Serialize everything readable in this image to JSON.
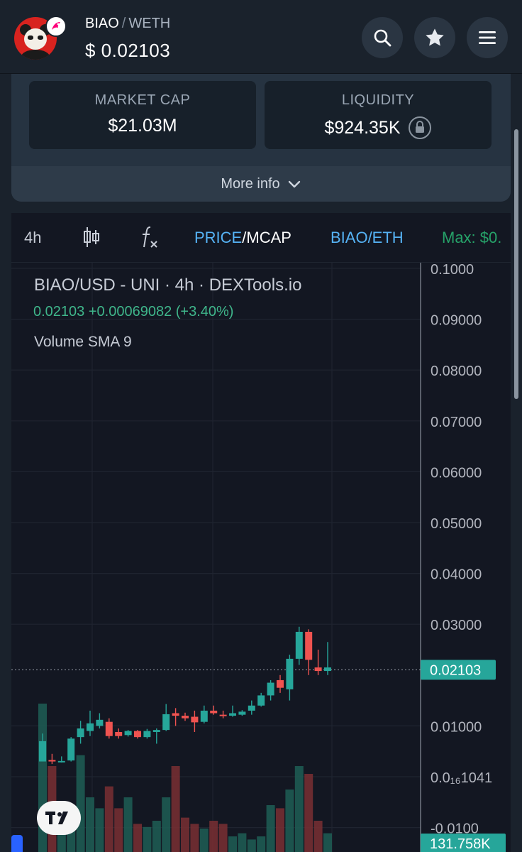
{
  "header": {
    "token_base": "BIAO",
    "separator": "/",
    "token_quote": "WETH",
    "price": "$ 0.02103"
  },
  "stats": {
    "market_cap_label": "MARKET CAP",
    "market_cap_value": "$21.03M",
    "liquidity_label": "LIQUIDITY",
    "liquidity_value": "$924.35K",
    "more_info": "More info"
  },
  "toolbar": {
    "interval": "4h",
    "price_label": "PRICE",
    "mcap_label": "/MCAP",
    "pair_label": "BIAO/ETH",
    "max_label": "Max: $0."
  },
  "chart_meta": {
    "title": "BIAO/USD - UNI · 4h · DEXTools.io",
    "ohlc": "0.02103  +0.00069082 (+3.40%)",
    "volume_label": "Volume SMA 9",
    "last_price_tag": "0.02103",
    "volume_tag": "131.758K",
    "tv_logo": "TV"
  },
  "colors": {
    "up": "#26a69a",
    "down": "#ef5350",
    "bg": "#131722",
    "accent": "#56b3f5"
  },
  "chart_data": {
    "type": "candlestick",
    "title": "BIAO/USD - UNI · 4h · DEXTools.io",
    "ylim": [
      -0.01,
      0.1
    ],
    "y_ticks": [
      "0.1000",
      "0.09000",
      "0.08000",
      "0.07000",
      "0.06000",
      "0.05000",
      "0.04000",
      "0.03000",
      "0.01000",
      "0.0₁₆1041",
      "-0.0100"
    ],
    "y_tick_values": [
      0.1,
      0.09,
      0.08,
      0.07,
      0.06,
      0.05,
      0.04,
      0.03,
      0.01,
      0.0,
      -0.01
    ],
    "last_price": 0.02103,
    "candles": [
      {
        "o": 0.003,
        "c": 0.007,
        "h": 0.0085,
        "l": 0.003
      },
      {
        "o": 0.0033,
        "c": 0.003,
        "h": 0.0045,
        "l": 0.0025
      },
      {
        "o": 0.0031,
        "c": 0.0031,
        "h": 0.004,
        "l": 0.0028
      },
      {
        "o": 0.0032,
        "c": 0.0075,
        "h": 0.0078,
        "l": 0.003
      },
      {
        "o": 0.0078,
        "c": 0.0095,
        "h": 0.011,
        "l": 0.0065
      },
      {
        "o": 0.009,
        "c": 0.0105,
        "h": 0.013,
        "l": 0.008
      },
      {
        "o": 0.01,
        "c": 0.0112,
        "h": 0.0125,
        "l": 0.0095
      },
      {
        "o": 0.0108,
        "c": 0.008,
        "h": 0.0115,
        "l": 0.0075
      },
      {
        "o": 0.0088,
        "c": 0.008,
        "h": 0.0095,
        "l": 0.0075
      },
      {
        "o": 0.0082,
        "c": 0.009,
        "h": 0.0092,
        "l": 0.0079
      },
      {
        "o": 0.009,
        "c": 0.0078,
        "h": 0.0092,
        "l": 0.0075
      },
      {
        "o": 0.0078,
        "c": 0.009,
        "h": 0.0094,
        "l": 0.0075
      },
      {
        "o": 0.0088,
        "c": 0.0092,
        "h": 0.0095,
        "l": 0.0065
      },
      {
        "o": 0.0092,
        "c": 0.0123,
        "h": 0.0143,
        "l": 0.009
      },
      {
        "o": 0.0125,
        "c": 0.012,
        "h": 0.0135,
        "l": 0.01
      },
      {
        "o": 0.012,
        "c": 0.0115,
        "h": 0.0126,
        "l": 0.011
      },
      {
        "o": 0.0118,
        "c": 0.0107,
        "h": 0.013,
        "l": 0.0088
      },
      {
        "o": 0.0108,
        "c": 0.013,
        "h": 0.014,
        "l": 0.0105
      },
      {
        "o": 0.013,
        "c": 0.0125,
        "h": 0.014,
        "l": 0.0122
      },
      {
        "o": 0.0122,
        "c": 0.012,
        "h": 0.013,
        "l": 0.0115
      },
      {
        "o": 0.012,
        "c": 0.0125,
        "h": 0.014,
        "l": 0.0118
      },
      {
        "o": 0.0122,
        "c": 0.0128,
        "h": 0.0131,
        "l": 0.012
      },
      {
        "o": 0.013,
        "c": 0.014,
        "h": 0.015,
        "l": 0.0122
      },
      {
        "o": 0.014,
        "c": 0.016,
        "h": 0.0165,
        "l": 0.0138
      },
      {
        "o": 0.016,
        "c": 0.0185,
        "h": 0.019,
        "l": 0.015
      },
      {
        "o": 0.019,
        "c": 0.0175,
        "h": 0.02,
        "l": 0.0165
      },
      {
        "o": 0.0172,
        "c": 0.0232,
        "h": 0.024,
        "l": 0.015
      },
      {
        "o": 0.0232,
        "c": 0.0285,
        "h": 0.0295,
        "l": 0.022
      },
      {
        "o": 0.0285,
        "c": 0.023,
        "h": 0.029,
        "l": 0.02
      },
      {
        "o": 0.0215,
        "c": 0.0208,
        "h": 0.025,
        "l": 0.02
      },
      {
        "o": 0.0208,
        "c": 0.0215,
        "h": 0.0265,
        "l": 0.02
      }
    ],
    "volumes": [
      0.95,
      0.55,
      0.12,
      0.25,
      0.62,
      0.35,
      0.28,
      0.42,
      0.28,
      0.35,
      0.18,
      0.16,
      0.2,
      0.35,
      0.55,
      0.22,
      0.18,
      0.15,
      0.2,
      0.18,
      0.1,
      0.12,
      0.08,
      0.1,
      0.3,
      0.28,
      0.4,
      0.55,
      0.5,
      0.2,
      0.12
    ]
  }
}
